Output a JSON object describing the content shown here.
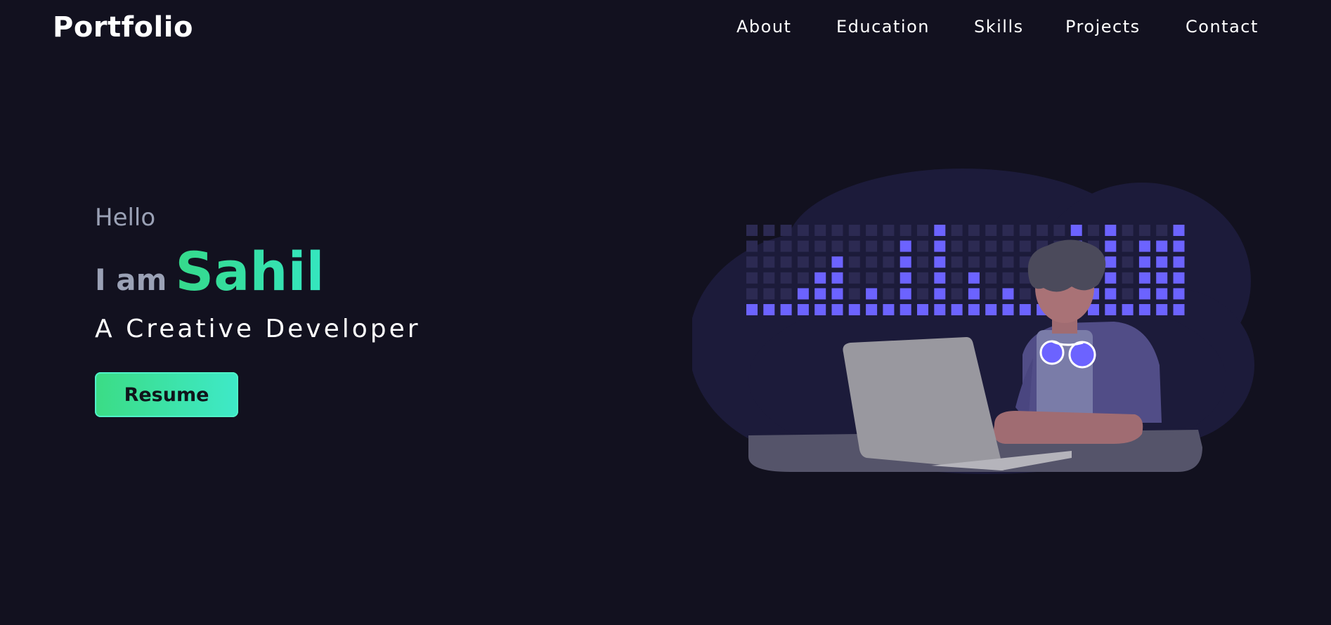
{
  "header": {
    "logo": "Portfolio",
    "nav": [
      {
        "label": "About"
      },
      {
        "label": "Education"
      },
      {
        "label": "Skills"
      },
      {
        "label": "Projects"
      },
      {
        "label": "Contact"
      }
    ]
  },
  "hero": {
    "greeting": "Hello",
    "intro": "I am",
    "name": "Sahil",
    "tagline": "A Creative Developer",
    "button_label": "Resume"
  },
  "colors": {
    "background": "#12111f",
    "accent_green": "#35d98a",
    "accent_teal": "#3ee9c8",
    "muted_text": "#9aa1b5",
    "illustration_purple": "#6c63ff"
  }
}
